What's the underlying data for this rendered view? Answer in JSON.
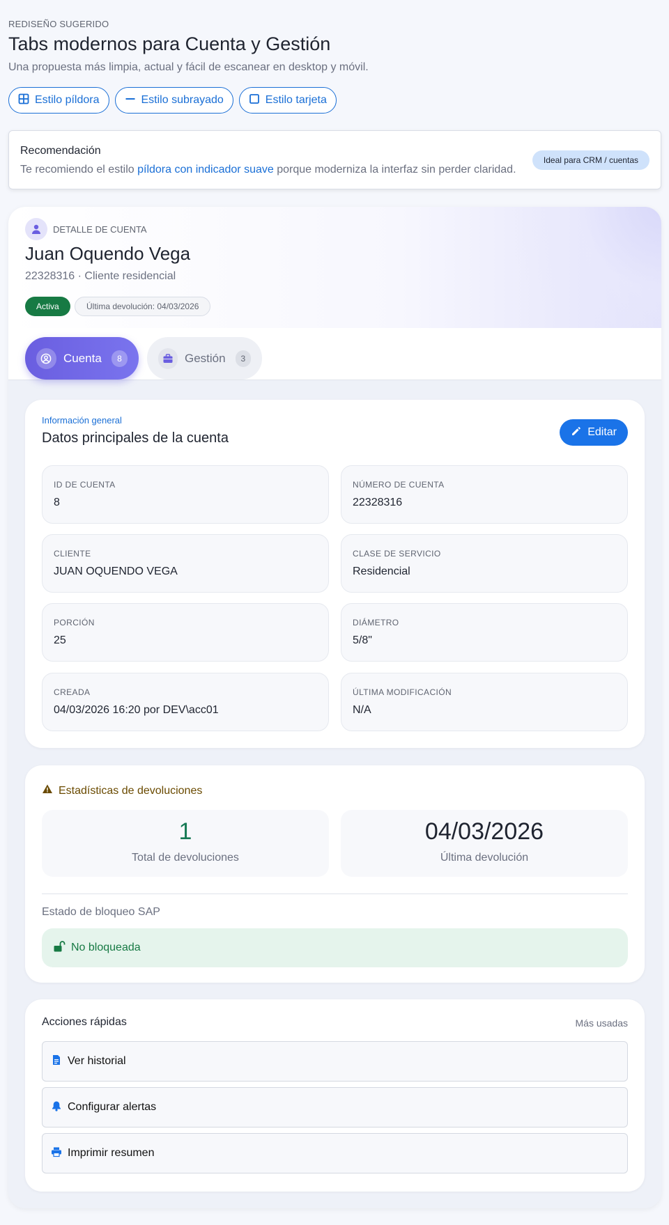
{
  "intro": {
    "eyebrow": "REDISEÑO SUGERIDO",
    "title": "Tabs modernos para Cuenta y Gestión",
    "subtitle": "Una propuesta más limpia, actual y fácil de escanear en desktop y móvil."
  },
  "style_options": [
    {
      "label": "Estilo píldora",
      "icon": "grid-icon"
    },
    {
      "label": "Estilo subrayado",
      "icon": "dash-icon"
    },
    {
      "label": "Estilo tarjeta",
      "icon": "square-icon"
    }
  ],
  "recommendation": {
    "title": "Recomendación",
    "text_before": "Te recomiendo el estilo ",
    "highlight": "píldora con indicador suave",
    "text_after": " porque moderniza la interfaz sin perder claridad.",
    "badge": "Ideal para CRM / cuentas"
  },
  "account": {
    "eyebrow": "DETALLE DE CUENTA",
    "name": "Juan Oquendo Vega",
    "subtitle": "22328316 · Cliente residencial",
    "status_badge": "Activa",
    "last_return_badge": "Última devolución: 04/03/2026"
  },
  "tabs": [
    {
      "label": "Cuenta",
      "count": "8",
      "icon": "user-circle-icon",
      "active": true
    },
    {
      "label": "Gestión",
      "count": "3",
      "icon": "briefcase-icon",
      "active": false
    }
  ],
  "info": {
    "eyebrow": "Información general",
    "title": "Datos principales de la cuenta",
    "edit_label": "Editar",
    "fields": [
      {
        "label": "ID DE CUENTA",
        "value": "8"
      },
      {
        "label": "NÚMERO DE CUENTA",
        "value": "22328316"
      },
      {
        "label": "CLIENTE",
        "value": "JUAN OQUENDO VEGA"
      },
      {
        "label": "CLASE DE SERVICIO",
        "value": "Residencial"
      },
      {
        "label": "PORCIÓN",
        "value": "25"
      },
      {
        "label": "DIÁMETRO",
        "value": "5/8\""
      },
      {
        "label": "CREADA",
        "value": "04/03/2026 16:20 por DEV\\acc01"
      },
      {
        "label": "ÚLTIMA MODIFICACIÓN",
        "value": "N/A"
      }
    ]
  },
  "stats": {
    "title": "Estadísticas de devoluciones",
    "total_value": "1",
    "total_label": "Total de devoluciones",
    "last_value": "04/03/2026",
    "last_label": "Última devolución",
    "sap_label": "Estado de bloqueo SAP",
    "sap_status": "No bloqueada"
  },
  "actions": {
    "title": "Acciones rápidas",
    "hint": "Más usadas",
    "items": [
      {
        "label": "Ver historial",
        "icon": "document-icon"
      },
      {
        "label": "Configurar alertas",
        "icon": "bell-icon"
      },
      {
        "label": "Imprimir resumen",
        "icon": "printer-icon"
      }
    ]
  },
  "colors": {
    "primary": "#1a73e8",
    "accent": "#6a5ee0",
    "success": "#177a44",
    "warning": "#6a4a00"
  }
}
